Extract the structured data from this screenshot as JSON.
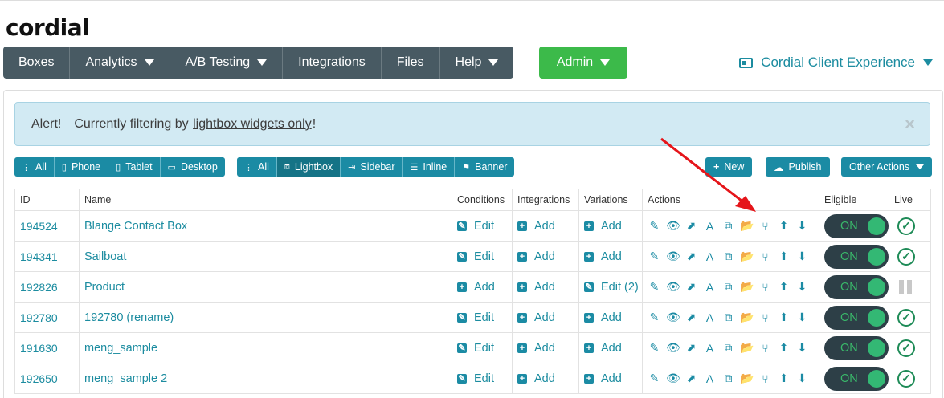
{
  "brand": {
    "logo": "cordial"
  },
  "nav": {
    "items": [
      {
        "label": "Boxes",
        "dropdown": false
      },
      {
        "label": "Analytics",
        "dropdown": true
      },
      {
        "label": "A/B Testing",
        "dropdown": true
      },
      {
        "label": "Integrations",
        "dropdown": false
      },
      {
        "label": "Files",
        "dropdown": false
      },
      {
        "label": "Help",
        "dropdown": true
      }
    ],
    "admin_label": "Admin",
    "client_label": "Cordial Client Experience"
  },
  "alert": {
    "head": "Alert!",
    "text_before": "Currently filtering by",
    "link": "lightbox widgets only",
    "text_after": "!",
    "close": "×"
  },
  "device_filters": [
    "All",
    "Phone",
    "Tablet",
    "Desktop"
  ],
  "type_filters": [
    "All",
    "Lightbox",
    "Sidebar",
    "Inline",
    "Banner"
  ],
  "action_buttons": {
    "new": "New",
    "publish": "Publish",
    "other": "Other Actions"
  },
  "table": {
    "headers": [
      "ID",
      "Name",
      "Conditions",
      "Integrations",
      "Variations",
      "Actions",
      "Eligible",
      "Live"
    ],
    "rows": [
      {
        "id": "194524",
        "name": "Blange Contact Box",
        "conditions": "Edit",
        "integrations": "Add",
        "variations": "Add",
        "eligible": "ON",
        "live": "ok"
      },
      {
        "id": "194341",
        "name": "Sailboat",
        "conditions": "Edit",
        "integrations": "Add",
        "variations": "Add",
        "eligible": "ON",
        "live": "ok"
      },
      {
        "id": "192826",
        "name": "Product",
        "conditions": "Add",
        "integrations": "Add",
        "variations": "Edit (2)",
        "eligible": "ON",
        "live": "paused"
      },
      {
        "id": "192780",
        "name": "192780 (rename)",
        "conditions": "Edit",
        "integrations": "Add",
        "variations": "Add",
        "eligible": "ON",
        "live": "ok"
      },
      {
        "id": "191630",
        "name": "meng_sample",
        "conditions": "Edit",
        "integrations": "Add",
        "variations": "Add",
        "eligible": "ON",
        "live": "ok"
      },
      {
        "id": "192650",
        "name": "meng_sample 2",
        "conditions": "Edit",
        "integrations": "Add",
        "variations": "Add",
        "eligible": "ON",
        "live": "ok"
      }
    ]
  },
  "icons": {
    "action_icons": [
      "edit-icon",
      "eye-icon",
      "external-link-icon",
      "font-icon",
      "copy-icon",
      "folder-icon",
      "branch-icon",
      "arrow-up-icon",
      "arrow-down-icon"
    ]
  },
  "colors": {
    "accent": "#1b8ba4",
    "nav": "#485a63",
    "admin": "#3cba4a",
    "annotation": "#e5151a"
  }
}
